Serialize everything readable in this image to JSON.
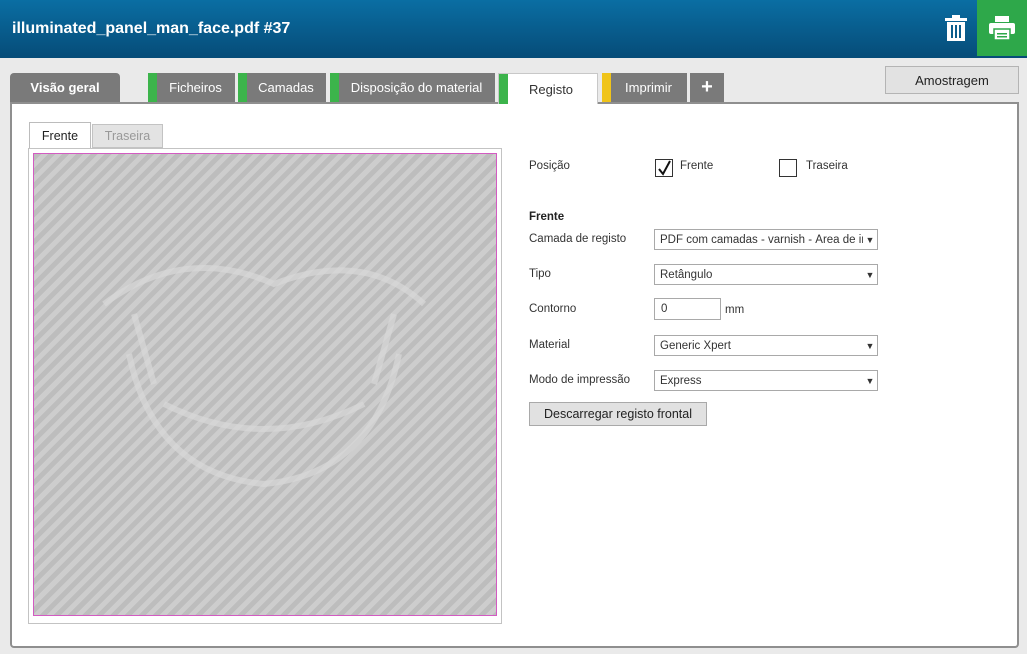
{
  "header": {
    "title": "illuminated_panel_man_face.pdf #37",
    "trash_icon": "trash-icon",
    "print_icon": "printer-icon",
    "print_bg": "#2ea84a"
  },
  "tabs": [
    {
      "label": "Visão geral",
      "flag": ""
    },
    {
      "label": "Ficheiros",
      "flag": "#3cb44b"
    },
    {
      "label": "Camadas",
      "flag": "#3cb44b"
    },
    {
      "label": "Disposição do material",
      "flag": "#3cb44b"
    },
    {
      "label": "Registo",
      "flag": "#3cb44b",
      "active": true
    },
    {
      "label": "Imprimir",
      "flag": "#f0c419"
    },
    {
      "label": "+",
      "flag": ""
    }
  ],
  "amostragem_label": "Amostragem",
  "side_tabs": {
    "front": "Frente",
    "back": "Traseira"
  },
  "form": {
    "position_label": "Posição",
    "position_front_label": "Frente",
    "position_front_checked": true,
    "position_back_label": "Traseira",
    "position_back_checked": false,
    "section_title": "Frente",
    "layer_label": "Camada de registo",
    "layer_value": "PDF com camadas - varnish - Área de ima",
    "type_label": "Tipo",
    "type_value": "Retângulo",
    "contour_label": "Contorno",
    "contour_value": "0",
    "contour_unit": "mm",
    "material_label": "Material",
    "material_value": "Generic Xpert",
    "print_mode_label": "Modo de impressão",
    "print_mode_value": "Express",
    "download_button": "Descarregar registo frontal"
  },
  "colors": {
    "header": "#0a6ea3",
    "tab_inactive": "#7a7a7a",
    "flag_green": "#3cb44b",
    "flag_yellow": "#f0c419",
    "preview_border": "#d35bc2"
  }
}
